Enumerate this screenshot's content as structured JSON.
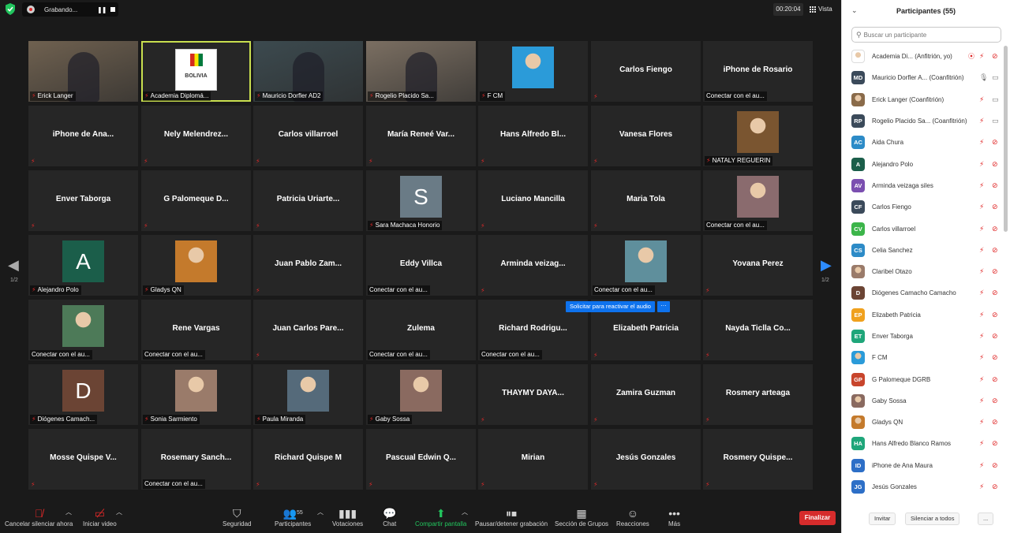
{
  "recording": {
    "label": "Grabando...",
    "pause_icon": "pause-icon",
    "stop_icon": "stop-icon"
  },
  "timer": "00:20:04",
  "view_label": "Vista",
  "pager": {
    "left": "1/2",
    "right": "1/2"
  },
  "tiles": [
    {
      "id": "t0",
      "label": "Erick Langer",
      "type": "video",
      "bg": "#6f6150"
    },
    {
      "id": "t1",
      "label": "Academia Diplomá...",
      "type": "logo",
      "active": true
    },
    {
      "id": "t2",
      "label": "Mauricio Dorfler AD2",
      "type": "video",
      "bg": "#3c4a4f"
    },
    {
      "id": "t3",
      "label": "Rogelio Placido Sa...",
      "type": "video",
      "bg": "#7b6f62"
    },
    {
      "id": "t4",
      "label": "F CM",
      "type": "avatar-img",
      "color": "#2b9bd9"
    },
    {
      "id": "t5",
      "center": "Carlos Fiengo"
    },
    {
      "id": "t6",
      "center": "iPhone de Rosario",
      "connect": "Conectar con el au..."
    },
    {
      "id": "t7",
      "center": "iPhone de Ana..."
    },
    {
      "id": "t8",
      "center": "Nely  Melendrez..."
    },
    {
      "id": "t9",
      "center": "Carlos villarroel"
    },
    {
      "id": "t10",
      "center": "María Reneé Var..."
    },
    {
      "id": "t11",
      "center": "Hans Alfredo Bl..."
    },
    {
      "id": "t12",
      "center": "Vanesa Flores"
    },
    {
      "id": "t13",
      "label": "NATALY REGUERIN",
      "type": "avatar-img",
      "color": "#7a5530"
    },
    {
      "id": "t14",
      "center": "Enver Taborga"
    },
    {
      "id": "t15",
      "center": "G  Palomeque D..."
    },
    {
      "id": "t16",
      "center": "Patricia  Uriarte..."
    },
    {
      "id": "t17",
      "label": "Sara Machaca Honorio",
      "type": "avatar-letter",
      "letter": "S",
      "color": "#6a7b86"
    },
    {
      "id": "t18",
      "center": "Luciano Mancilla"
    },
    {
      "id": "t19",
      "center": "Maria Tola"
    },
    {
      "id": "t20",
      "label": "Conectar con el au...",
      "type": "avatar-img",
      "color": "#8a6b6e",
      "connectlabel": true
    },
    {
      "id": "t21",
      "label": "Alejandro Polo",
      "type": "avatar-letter",
      "letter": "A",
      "color": "#1b5e4a"
    },
    {
      "id": "t22",
      "label": "Gladys QN",
      "type": "avatar-img",
      "color": "#c47a2c"
    },
    {
      "id": "t23",
      "center": "Juan Pablo Zam..."
    },
    {
      "id": "t24",
      "center": "Eddy Villca",
      "connect": "Conectar con el au..."
    },
    {
      "id": "t25",
      "center": "Arminda  veizag..."
    },
    {
      "id": "t26",
      "label": "Conectar con el au...",
      "type": "avatar-img",
      "color": "#5f8f9c",
      "connectlabel": true
    },
    {
      "id": "t27",
      "center": "Yovana Perez"
    },
    {
      "id": "t28",
      "label": "Conectar con el au...",
      "type": "avatar-img",
      "color": "#4d7a58",
      "connectlabel": true
    },
    {
      "id": "t29",
      "center": "Rene Vargas",
      "connect": "Conectar con el au..."
    },
    {
      "id": "t30",
      "center": "Juan Carlos Pare..."
    },
    {
      "id": "t31",
      "center": "Zulema",
      "connect": "Conectar con el au..."
    },
    {
      "id": "t32",
      "center": "Richard  Rodrigu...",
      "connect": "Conectar con el au..."
    },
    {
      "id": "t33",
      "center": "Elizabeth Patricia"
    },
    {
      "id": "t34",
      "center": "Nayda  Ticlla Co..."
    },
    {
      "id": "t35",
      "label": "Diógenes Camach...",
      "type": "avatar-letter",
      "letter": "D",
      "color": "#6b4434"
    },
    {
      "id": "t36",
      "label": "Sonia Sarmiento",
      "type": "avatar-img",
      "color": "#9a7b6a"
    },
    {
      "id": "t37",
      "label": "Paula Miranda",
      "type": "avatar-img",
      "color": "#556a7a"
    },
    {
      "id": "t38",
      "label": "Gaby Sossa",
      "type": "avatar-img",
      "color": "#8a6a60"
    },
    {
      "id": "t39",
      "center": "THAYMY  DAYA..."
    },
    {
      "id": "t40",
      "center": "Zamira Guzman"
    },
    {
      "id": "t41",
      "center": "Rosmery arteaga"
    },
    {
      "id": "t42",
      "center": "Mosse  Quispe  V..."
    },
    {
      "id": "t43",
      "center": "Rosemary  Sanch...",
      "connect": "Conectar con el au..."
    },
    {
      "id": "t44",
      "center": "Richard Quispe M"
    },
    {
      "id": "t45",
      "center": "Pascual  Edwin  Q..."
    },
    {
      "id": "t46",
      "center": "Mirian"
    },
    {
      "id": "t47",
      "center": "Jesús Gonzales"
    },
    {
      "id": "t48",
      "center": "Rosmery  Quispe..."
    }
  ],
  "request_unmute": {
    "label": "Solicitar para reactivar el audio",
    "more": "···"
  },
  "toolbar": {
    "mute_label": "Cancelar silenciar ahora",
    "video_label": "Iniciar video",
    "security_label": "Seguridad",
    "participants_label": "Participantes",
    "participants_count": "55",
    "polls_label": "Votaciones",
    "chat_label": "Chat",
    "share_label": "Compartir pantalla",
    "record_label": "Pausar/detener grabación",
    "breakout_label": "Sección de Grupos",
    "reactions_label": "Reacciones",
    "more_label": "Más",
    "end_label": "Finalizar"
  },
  "panel": {
    "title": "Participantes (55)",
    "search_placeholder": "Buscar un participante",
    "invite_label": "Invitar",
    "mute_all_label": "Silenciar a todos",
    "more_label": "...",
    "participants": [
      {
        "name": "Academia Di...  (Anfitrión, yo)",
        "initials": "",
        "color": "#ffffff",
        "img": true,
        "mic": "muted",
        "video": "off",
        "rec": true
      },
      {
        "name": "Mauricio Dorfler A... (Coanfitrión)",
        "initials": "MD",
        "color": "#3b4a5a",
        "mic": "on",
        "video": "on"
      },
      {
        "name": "Erick Langer (Coanfitrión)",
        "initials": "",
        "color": "#8a6b4a",
        "img": true,
        "mic": "muted",
        "video": "on"
      },
      {
        "name": "Rogelio Placido Sa... (Coanfitrión)",
        "initials": "RP",
        "color": "#3b4a5a",
        "mic": "muted",
        "video": "on"
      },
      {
        "name": "Aida Chura",
        "initials": "AC",
        "color": "#2d8bc7",
        "mic": "muted",
        "video": "off"
      },
      {
        "name": "Alejandro Polo",
        "initials": "A",
        "color": "#1b5e4a",
        "mic": "muted",
        "video": "off"
      },
      {
        "name": "Arminda veizaga siles",
        "initials": "AV",
        "color": "#7b4fb0",
        "mic": "muted",
        "video": "off"
      },
      {
        "name": "Carlos Fiengo",
        "initials": "CF",
        "color": "#3b4a5a",
        "mic": "muted",
        "video": "off"
      },
      {
        "name": "Carlos villarroel",
        "initials": "CV",
        "color": "#3cb54a",
        "mic": "muted",
        "video": "off"
      },
      {
        "name": "Celia Sanchez",
        "initials": "CS",
        "color": "#2d8bc7",
        "mic": "muted",
        "video": "off"
      },
      {
        "name": "Claribel Otazo",
        "initials": "",
        "color": "#9a7b6a",
        "img": true,
        "mic": "muted",
        "video": "off"
      },
      {
        "name": "Diógenes Camacho Camacho",
        "initials": "D",
        "color": "#6b4434",
        "mic": "muted",
        "video": "off"
      },
      {
        "name": "Elizabeth Patricia",
        "initials": "EP",
        "color": "#f0a11e",
        "mic": "muted",
        "video": "off"
      },
      {
        "name": "Enver Taborga",
        "initials": "ET",
        "color": "#1fa67a",
        "mic": "muted",
        "video": "off"
      },
      {
        "name": "F CM",
        "initials": "",
        "color": "#2b9bd9",
        "img": true,
        "mic": "muted",
        "video": "off"
      },
      {
        "name": "G Palomeque DGRB",
        "initials": "GP",
        "color": "#c8452c",
        "mic": "muted",
        "video": "off"
      },
      {
        "name": "Gaby Sossa",
        "initials": "",
        "color": "#8a6a60",
        "img": true,
        "mic": "muted",
        "video": "off"
      },
      {
        "name": "Gladys QN",
        "initials": "",
        "color": "#c47a2c",
        "img": true,
        "mic": "muted",
        "video": "off"
      },
      {
        "name": "Hans Alfredo Blanco Ramos",
        "initials": "HA",
        "color": "#1fa67a",
        "mic": "muted",
        "video": "off"
      },
      {
        "name": "iPhone de Ana Maura",
        "initials": "ID",
        "color": "#2d6fc7",
        "mic": "muted",
        "video": "off"
      },
      {
        "name": "Jesús Gonzales",
        "initials": "JG",
        "color": "#2d6fc7",
        "mic": "muted",
        "video": "off"
      }
    ]
  }
}
